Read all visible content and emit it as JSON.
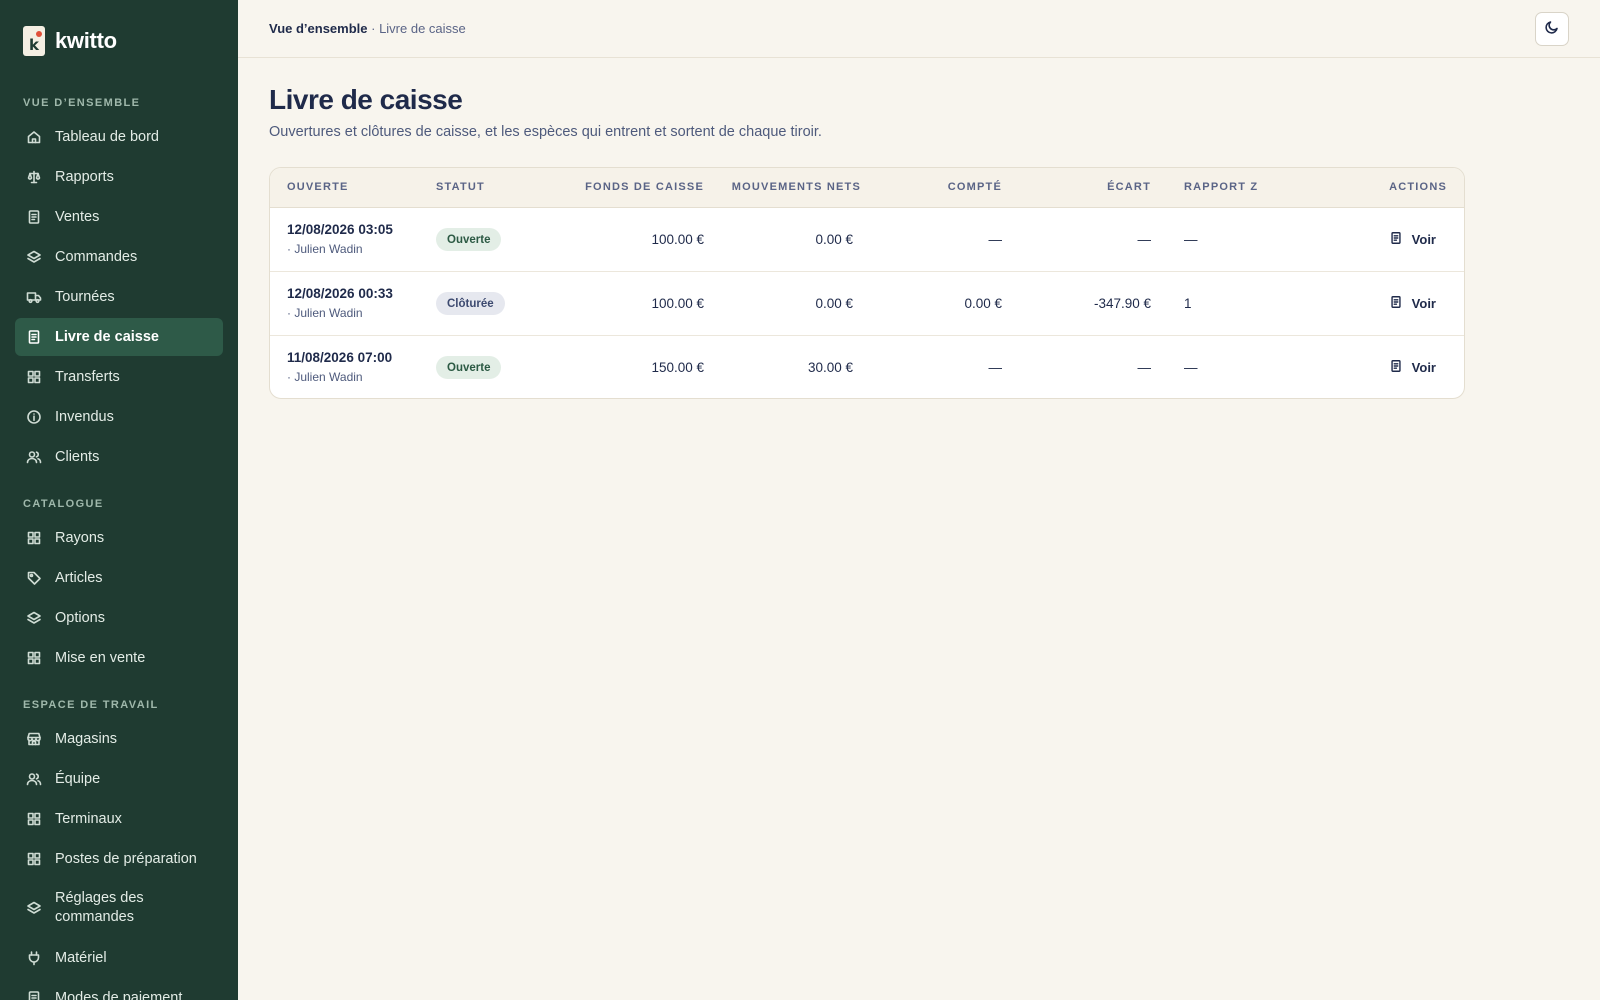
{
  "app": {
    "brand": "kwitto",
    "logo_letter": "k"
  },
  "sidebar": {
    "sections": [
      {
        "label": "VUE D’ENSEMBLE"
      },
      {
        "label": "CATALOGUE"
      },
      {
        "label": "ESPACE DE TRAVAIL"
      }
    ],
    "items": [
      {
        "label": "Tableau de bord",
        "icon": "home-icon"
      },
      {
        "label": "Rapports",
        "icon": "scale-icon"
      },
      {
        "label": "Ventes",
        "icon": "receipt-icon"
      },
      {
        "label": "Commandes",
        "icon": "layers-icon"
      },
      {
        "label": "Tournées",
        "icon": "truck-icon"
      },
      {
        "label": "Livre de caisse",
        "icon": "receipt-icon",
        "active": true
      },
      {
        "label": "Transferts",
        "icon": "grid-icon"
      },
      {
        "label": "Invendus",
        "icon": "info-icon"
      },
      {
        "label": "Clients",
        "icon": "users-icon"
      },
      {
        "label": "Rayons",
        "icon": "grid-icon"
      },
      {
        "label": "Articles",
        "icon": "tag-icon"
      },
      {
        "label": "Options",
        "icon": "layers-icon"
      },
      {
        "label": "Mise en vente",
        "icon": "grid-icon"
      },
      {
        "label": "Magasins",
        "icon": "store-icon"
      },
      {
        "label": "Équipe",
        "icon": "users-icon"
      },
      {
        "label": "Terminaux",
        "icon": "grid-icon"
      },
      {
        "label": "Postes de préparation",
        "icon": "grid-icon"
      },
      {
        "label": "Réglages des commandes",
        "icon": "layers-icon"
      },
      {
        "label": "Matériel",
        "icon": "plug-icon"
      },
      {
        "label": "Modes de paiement",
        "icon": "receipt-icon"
      }
    ]
  },
  "header": {
    "breadcrumb_root": "Vue d’ensemble",
    "breadcrumb_sep": " · ",
    "breadcrumb_current": "Livre de caisse",
    "theme_toggle_icon": "moon-icon"
  },
  "main": {
    "title": "Livre de caisse",
    "subtitle": "Ouvertures et clôtures de caisse, et les espèces qui entrent et sortent de chaque tiroir."
  },
  "table": {
    "columns": [
      "OUVERTE",
      "STATUT",
      "FONDS DE CAISSE",
      "MOUVEMENTS NETS",
      "COMPTÉ",
      "ÉCART",
      "RAPPORT Z",
      "ACTIONS"
    ],
    "rows": [
      {
        "opened": "12/08/2026 03:05",
        "user": "· Julien Wadin",
        "status": "Ouverte",
        "status_type": "open",
        "float": "100.00 €",
        "net": "0.00 €",
        "counted": "—",
        "diff": "—",
        "zreport": "—",
        "action": "Voir"
      },
      {
        "opened": "12/08/2026 00:33",
        "user": "· Julien Wadin",
        "status": "Clôturée",
        "status_type": "closed",
        "float": "100.00 €",
        "net": "0.00 €",
        "counted": "0.00 €",
        "diff": "-347.90 €",
        "zreport": "1",
        "action": "Voir"
      },
      {
        "opened": "11/08/2026 07:00",
        "user": "· Julien Wadin",
        "status": "Ouverte",
        "status_type": "open",
        "float": "150.00 €",
        "net": "30.00 €",
        "counted": "—",
        "diff": "—",
        "zreport": "—",
        "action": "Voir"
      }
    ]
  }
}
